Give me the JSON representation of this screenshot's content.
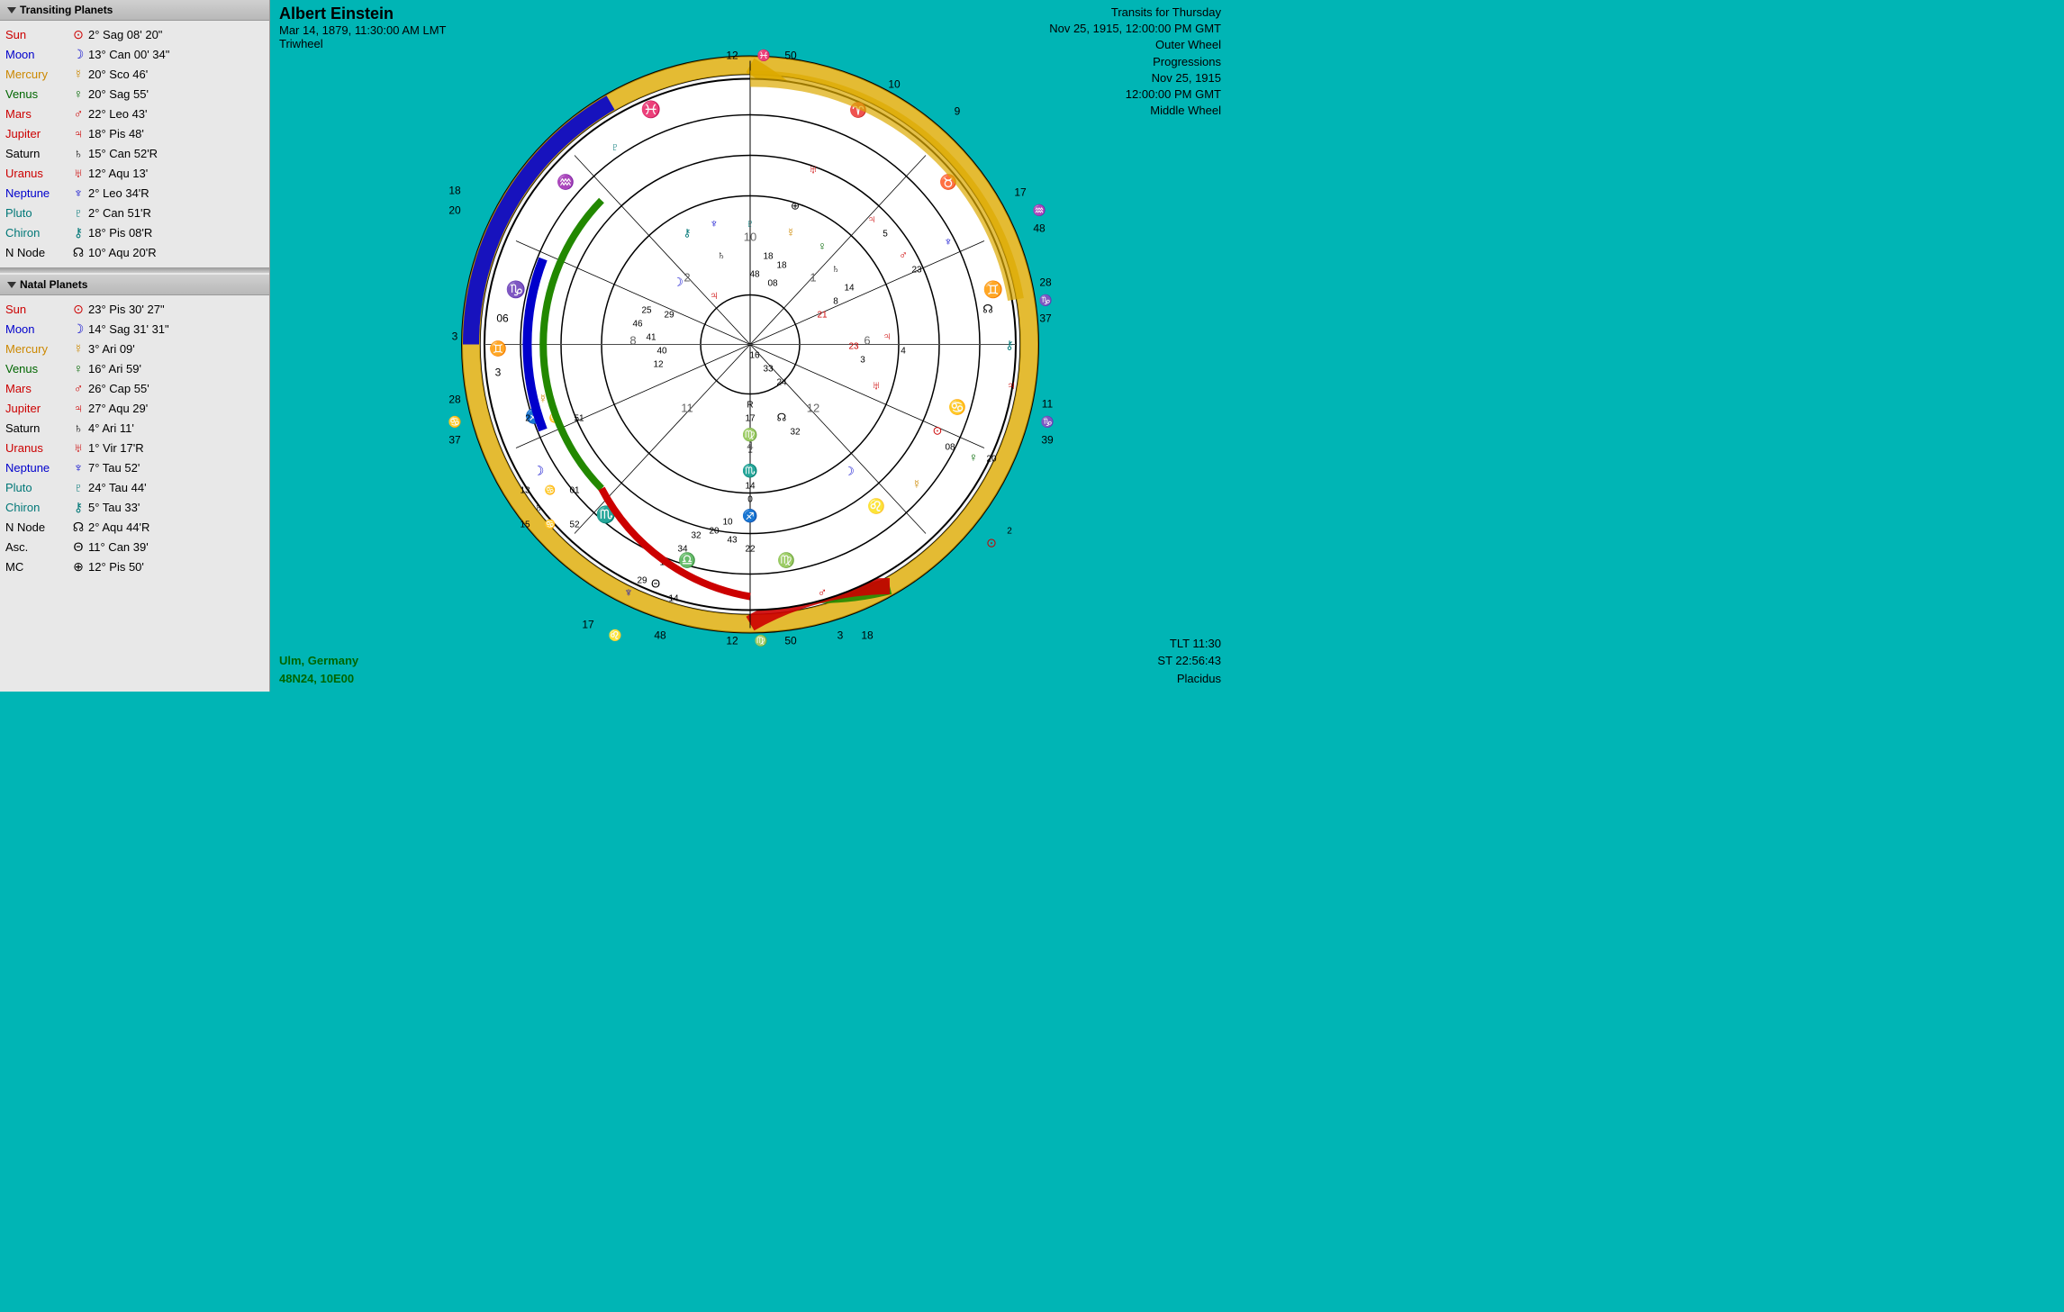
{
  "leftPanel": {
    "transitingHeader": "Transiting Planets",
    "transitingPlanets": [
      {
        "name": "Sun",
        "symbol": "⊙",
        "position": "2° Sag 08' 20\"",
        "nameColor": "color-red",
        "symbolColor": "color-red"
      },
      {
        "name": "Moon",
        "symbol": "☽",
        "position": "13° Can 00' 34\"",
        "nameColor": "color-blue",
        "symbolColor": "color-blue"
      },
      {
        "name": "Mercury",
        "symbol": "☿",
        "position": "20° Sco 46'",
        "nameColor": "color-gold",
        "symbolColor": "color-gold"
      },
      {
        "name": "Venus",
        "symbol": "♀",
        "position": "20° Sag 55'",
        "nameColor": "color-green",
        "symbolColor": "color-green"
      },
      {
        "name": "Mars",
        "symbol": "♂",
        "position": "22° Leo 43'",
        "nameColor": "color-red",
        "symbolColor": "color-red"
      },
      {
        "name": "Jupiter",
        "symbol": "♃",
        "position": "18° Pis 48'",
        "nameColor": "color-red",
        "symbolColor": "color-red"
      },
      {
        "name": "Saturn",
        "symbol": "♄",
        "position": "15° Can 52'R",
        "nameColor": "color-black",
        "symbolColor": "color-black"
      },
      {
        "name": "Uranus",
        "symbol": "♅",
        "position": "12° Aqu 13'",
        "nameColor": "color-red",
        "symbolColor": "color-red"
      },
      {
        "name": "Neptune",
        "symbol": "♆",
        "position": "2° Leo 34'R",
        "nameColor": "color-blue",
        "symbolColor": "color-blue"
      },
      {
        "name": "Pluto",
        "symbol": "♇",
        "position": "2° Can 51'R",
        "nameColor": "color-teal",
        "symbolColor": "color-teal"
      },
      {
        "name": "Chiron",
        "symbol": "⚷",
        "position": "18° Pis 08'R",
        "nameColor": "color-teal",
        "symbolColor": "color-teal"
      },
      {
        "name": "N Node",
        "symbol": "☊",
        "position": "10° Aqu 20'R",
        "nameColor": "color-black",
        "symbolColor": "color-black"
      }
    ],
    "natalHeader": "Natal Planets",
    "natalPlanets": [
      {
        "name": "Sun",
        "symbol": "⊙",
        "position": "23° Pis 30' 27\"",
        "nameColor": "color-red",
        "symbolColor": "color-red"
      },
      {
        "name": "Moon",
        "symbol": "☽",
        "position": "14° Sag 31' 31\"",
        "nameColor": "color-blue",
        "symbolColor": "color-blue"
      },
      {
        "name": "Mercury",
        "symbol": "☿",
        "position": "3° Ari 09'",
        "nameColor": "color-gold",
        "symbolColor": "color-gold"
      },
      {
        "name": "Venus",
        "symbol": "♀",
        "position": "16° Ari 59'",
        "nameColor": "color-green",
        "symbolColor": "color-green"
      },
      {
        "name": "Mars",
        "symbol": "♂",
        "position": "26° Cap 55'",
        "nameColor": "color-red",
        "symbolColor": "color-red"
      },
      {
        "name": "Jupiter",
        "symbol": "♃",
        "position": "27° Aqu 29'",
        "nameColor": "color-red",
        "symbolColor": "color-red"
      },
      {
        "name": "Saturn",
        "symbol": "♄",
        "position": "4° Ari 11'",
        "nameColor": "color-black",
        "symbolColor": "color-black"
      },
      {
        "name": "Uranus",
        "symbol": "♅",
        "position": "1° Vir 17'R",
        "nameColor": "color-red",
        "symbolColor": "color-red"
      },
      {
        "name": "Neptune",
        "symbol": "♆",
        "position": "7° Tau 52'",
        "nameColor": "color-blue",
        "symbolColor": "color-blue"
      },
      {
        "name": "Pluto",
        "symbol": "♇",
        "position": "24° Tau 44'",
        "nameColor": "color-teal",
        "symbolColor": "color-teal"
      },
      {
        "name": "Chiron",
        "symbol": "⚷",
        "position": "5° Tau 33'",
        "nameColor": "color-teal",
        "symbolColor": "color-teal"
      },
      {
        "name": "N Node",
        "symbol": "☊",
        "position": "2° Aqu 44'R",
        "nameColor": "color-black",
        "symbolColor": "color-black"
      },
      {
        "name": "Asc.",
        "symbol": "Θ",
        "position": "11° Can 39'",
        "nameColor": "color-black",
        "symbolColor": "color-black"
      },
      {
        "name": "MC",
        "symbol": "⊕",
        "position": "12° Pis 50'",
        "nameColor": "color-black",
        "symbolColor": "color-black"
      }
    ]
  },
  "chartTitle": {
    "name": "Albert Einstein",
    "date": "Mar 14, 1879, 11:30:00 AM LMT",
    "type": "Triwheel"
  },
  "transitInfo": {
    "line1": "Transits for Thursday",
    "line2": "Nov 25, 1915, 12:00:00 PM GMT",
    "line3": "Outer Wheel",
    "line4": "Progressions",
    "line5": "Nov 25, 1915",
    "line6": "12:00:00 PM GMT",
    "line7": "Middle Wheel"
  },
  "locationInfo": {
    "city": "Ulm, Germany",
    "coords": "48N24, 10E00"
  },
  "timeInfo": {
    "tlt": "TLT 11:30",
    "st": "ST 22:56:43",
    "system": "Placidus"
  }
}
